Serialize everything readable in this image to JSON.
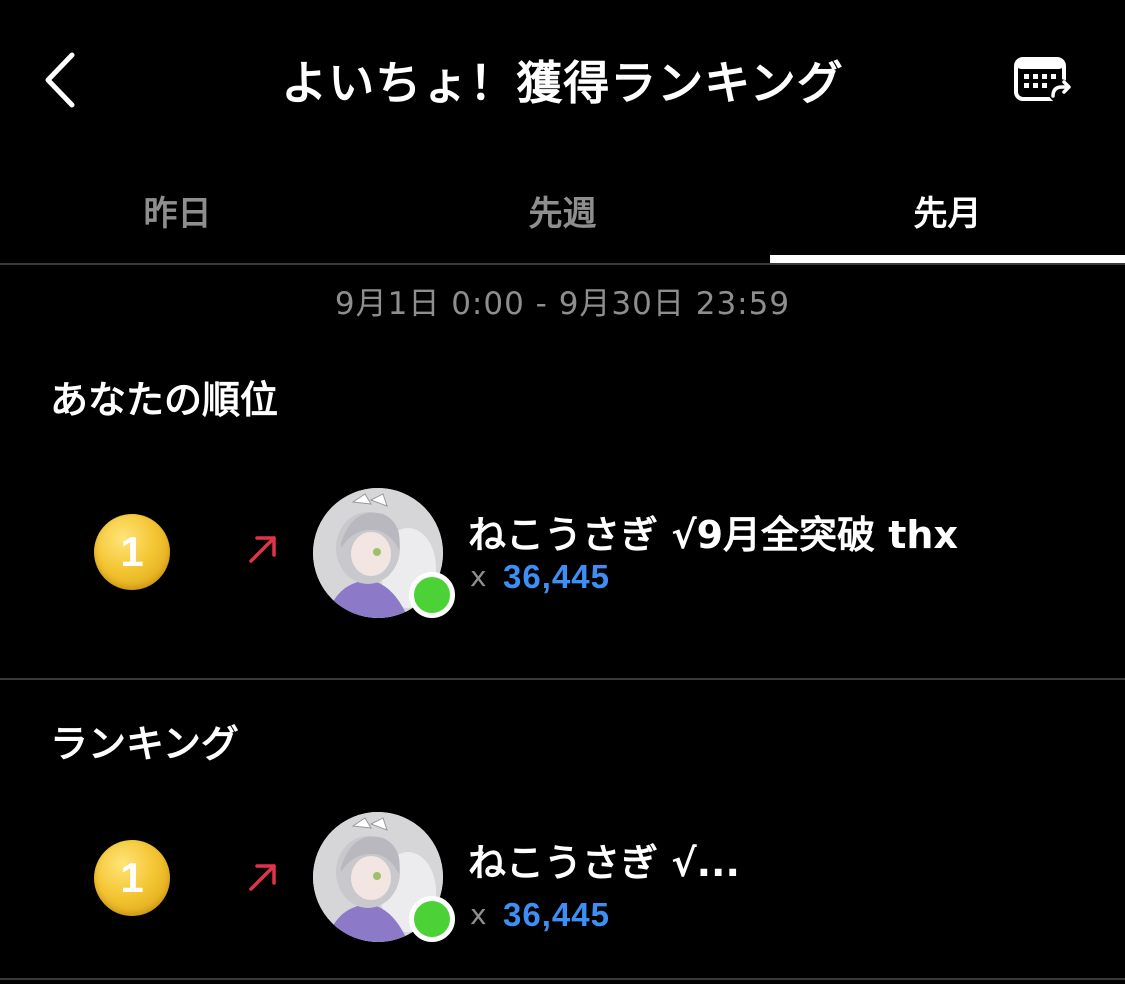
{
  "header": {
    "back_icon": "chevron-left-icon",
    "title": "よいちょ！獲得ランキング",
    "calendar_icon": "calendar-share-icon"
  },
  "tabs": [
    {
      "label": "昨日",
      "active": false
    },
    {
      "label": "先週",
      "active": false
    },
    {
      "label": "先月",
      "active": true
    }
  ],
  "period": "9月1日 0:00 - 9月30日 23:59",
  "my_rank": {
    "section_title": "あなたの順位",
    "rank": "1",
    "trend_icon": "trend-up-icon",
    "name": "ねこうさぎ √9月全突破 thx",
    "score_prefix": "x",
    "score": "36,445",
    "online": true
  },
  "ranking": {
    "section_title": "ランキング",
    "items": [
      {
        "rank": "1",
        "trend_icon": "trend-up-icon",
        "name": "ねこうさぎ √...",
        "score_prefix": "x",
        "score": "36,445",
        "online": true
      }
    ]
  },
  "colors": {
    "background": "#000000",
    "accent_blue": "#3d8ff5",
    "medal_gold": "#f4c634",
    "trend_red": "#e0334a",
    "online_green": "#4cd137",
    "muted_text": "#8e8e8e"
  }
}
